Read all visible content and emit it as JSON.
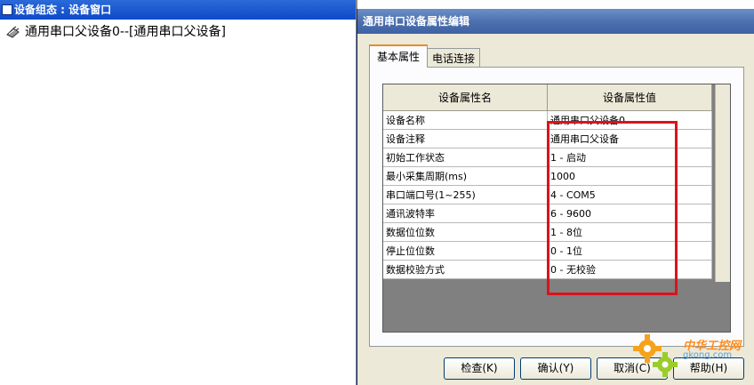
{
  "left_window": {
    "title": "设备组态 : 设备窗口",
    "tree_item": "通用串口父设备0--[通用串口父设备]"
  },
  "dialog": {
    "title": "通用串口设备属性编辑",
    "tabs": [
      "基本属性",
      "电话连接"
    ],
    "active_tab": 0,
    "grid": {
      "headers": [
        "设备属性名",
        "设备属性值"
      ],
      "rows": [
        {
          "name": "设备名称",
          "value": "通用串口父设备0"
        },
        {
          "name": "设备注释",
          "value": "通用串口父设备"
        },
        {
          "name": "初始工作状态",
          "value": "1 - 启动"
        },
        {
          "name": "最小采集周期(ms)",
          "value": "1000"
        },
        {
          "name": "串口端口号(1~255)",
          "value": "4 - COM5"
        },
        {
          "name": "通讯波特率",
          "value": "6 - 9600"
        },
        {
          "name": "数据位位数",
          "value": "1 - 8位"
        },
        {
          "name": "停止位位数",
          "value": "0 - 1位"
        },
        {
          "name": "数据校验方式",
          "value": "0 - 无校验"
        }
      ]
    },
    "buttons": [
      "检查(K)",
      "确认(Y)",
      "取消(C)",
      "帮助(H)"
    ]
  },
  "watermark": {
    "brand": "中华工控网",
    "url": "gkong.com"
  },
  "colors": {
    "title_bar": "#0f49c8",
    "dialog_title": "#4a6eae",
    "highlight_box": "#d8141d",
    "dialog_bg": "#ece9d8"
  }
}
